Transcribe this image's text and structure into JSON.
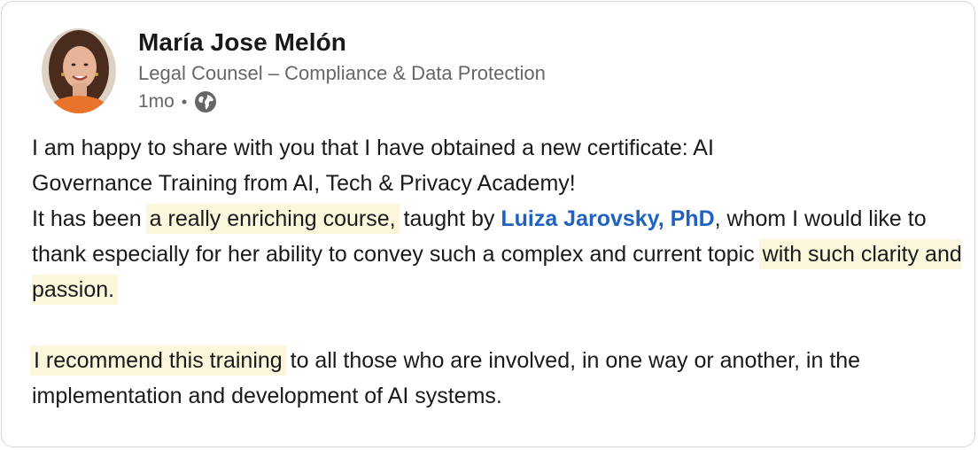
{
  "post": {
    "author": {
      "name": "María Jose Melón",
      "headline": "Legal Counsel – Compliance & Data Protection",
      "time": "1mo",
      "separator": "•",
      "visibility_icon": "globe-icon"
    },
    "body": {
      "p1_line1": "I am happy to share with you that I have obtained a new certificate: AI",
      "p1_line2": "Governance Training from AI, Tech & Privacy Academy!",
      "p2_seg1": "It has been ",
      "p2_hl1": "a really enriching course,",
      "p2_seg2": " taught by ",
      "p2_mention": "Luiza Jarovsky, PhD",
      "p2_seg3": ", whom I would like to thank especially for her ability to convey such a complex and current topic ",
      "p2_hl2": "with such clarity and passion.",
      "p3_hl": "I recommend this training",
      "p3_rest": " to all those who are involved, in one way or another, in the implementation and development of AI systems."
    }
  },
  "colors": {
    "highlight": "#fbf7dc",
    "mention": "#1f62c1",
    "text": "#1a1a1a",
    "secondary": "#666666"
  }
}
